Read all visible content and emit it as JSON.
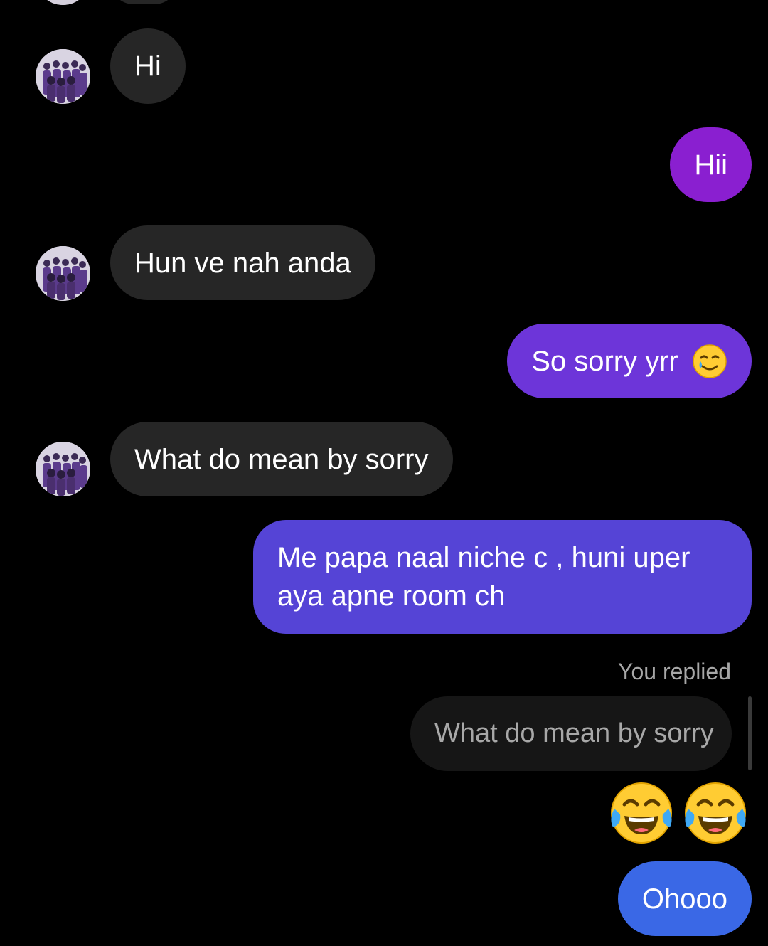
{
  "messages": {
    "m1": "Hi",
    "m2": "Hii",
    "m3": "Hun ve nah anda",
    "m4": "So sorry yrr",
    "m5": "What do mean by sorry",
    "m6": "Me papa naal niche c , huni uper aya apne room ch",
    "m7": "Ohooo"
  },
  "reply": {
    "label": "You replied",
    "quoted": "What do mean by sorry"
  },
  "icons": {
    "avatar": "group-photo-avatar",
    "sorry_emoji": "smiling-face-with-tear-icon",
    "laugh_emoji": "face-with-tears-of-joy-icon"
  },
  "colors": {
    "background": "#000000",
    "incoming_bubble": "#262626",
    "outgoing_purple": "#8a1fd0",
    "outgoing_violet": "#6d35d9",
    "outgoing_indigo": "#5544d6",
    "outgoing_blue": "#3a68e6"
  }
}
